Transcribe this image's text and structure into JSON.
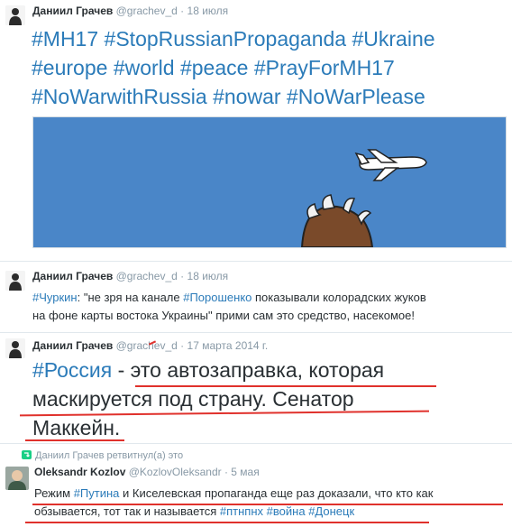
{
  "tweet1": {
    "name": "Даниил Грачев",
    "handle": "@grachev_d",
    "date": "18 июля",
    "tags": [
      "#MH17",
      "#StopRussianPropaganda",
      "#Ukraine",
      "#europe",
      "#world",
      "#peace",
      "#PrayForMH17",
      "#NoWarwithRussia",
      "#nowar",
      "#NoWarPlease"
    ],
    "image_bg": "#4a86c8"
  },
  "tweet2": {
    "name": "Даниил Грачев",
    "handle": "@grachev_d",
    "date": "18 июля",
    "tag1": "#Чуркин",
    "t1": ": \"не зря на канале ",
    "tag2": "#Порошенко",
    "t2": " показывали колорадских жуков",
    "line2": "на фоне карты востока Украины\" прими сам это средство, насекомое!"
  },
  "tweet3": {
    "name": "Даниил Грачев",
    "handle": "@grachev_d",
    "date": "17 марта 2014 г.",
    "tag": "#Россия",
    "line1_rest": " - это автозаправка, которая",
    "line2": "маскируется под страну. Сенатор",
    "line3": "Маккейн."
  },
  "tweet4": {
    "retweet_label": "Даниил Грачев ретвитнул(а) это",
    "name": "Oleksandr Kozlov",
    "handle": "@KozlovOleksandr",
    "date": "5 мая",
    "l1a": "Режим ",
    "tag1": "#Путина",
    "l1b": " и Киселевская пропаганда еще раз доказали, что кто как",
    "l2a": "обзывается, тот так и называется ",
    "tag2": "#птнпнх",
    "tag3": "#война",
    "tag4": "#Донецк"
  },
  "colors": {
    "link": "#2b7bb9",
    "underline": "#e0312c",
    "meta": "#8899a6",
    "retweet": "#19cf86"
  }
}
